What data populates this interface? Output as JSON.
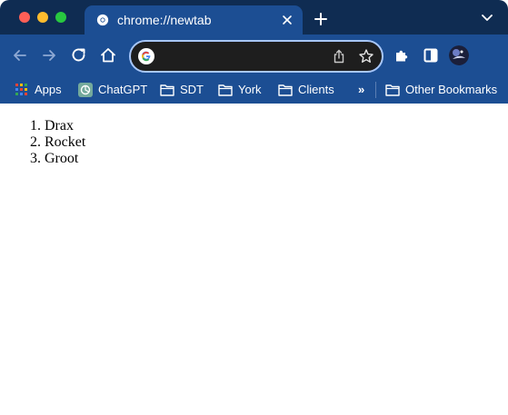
{
  "tab": {
    "title": "chrome://newtab"
  },
  "omnibox": {
    "value": "",
    "placeholder": ""
  },
  "bookmarks": [
    {
      "label": "Apps",
      "icon": "apps-grid-icon"
    },
    {
      "label": "ChatGPT",
      "icon": "chatgpt-icon"
    },
    {
      "label": "SDT",
      "icon": "folder-icon"
    },
    {
      "label": "York",
      "icon": "folder-icon"
    },
    {
      "label": "Clients",
      "icon": "folder-icon"
    },
    {
      "label": "»",
      "icon": "overflow-chevron-icon"
    },
    {
      "label": "Other Bookmarks",
      "icon": "folder-icon"
    }
  ],
  "page": {
    "list": [
      "Drax",
      "Rocket",
      "Groot"
    ]
  },
  "colors": {
    "tabstrip": "#0f2c52",
    "toolbar": "#1c4e93",
    "omnibox_bg": "#1e1e1e",
    "omnibox_border": "#a8c7fa"
  }
}
